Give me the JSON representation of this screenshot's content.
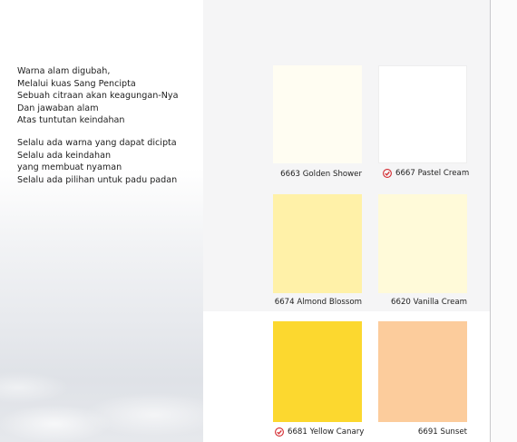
{
  "poem": {
    "stanza1": [
      "Warna alam digubah,",
      "Melalui kuas Sang Pencipta",
      "Sebuah citraan akan keagungan-Nya",
      "Dan jawaban alam",
      "Atas tuntutan keindahan"
    ],
    "stanza2": [
      "Selalu ada warna yang dapat dicipta",
      "Selalu ada keindahan",
      "yang membuat nyaman",
      "Selalu ada pilihan untuk padu padan"
    ]
  },
  "swatches": [
    {
      "code_name": "6663 Golden Shower",
      "color": "#fffdf2",
      "badge": false
    },
    {
      "code_name": "6667 Pastel Cream",
      "color": "#ffffff",
      "badge": true
    },
    {
      "code_name": "6674 Almond Blossom",
      "color": "#fff1a8",
      "badge": false
    },
    {
      "code_name": "6620 Vanilla Cream",
      "color": "#fffad9",
      "badge": false
    },
    {
      "code_name": "6681 Yellow Canary",
      "color": "#fcd82f",
      "badge": true
    },
    {
      "code_name": "6691 Sunset",
      "color": "#fccc9c",
      "badge": false
    }
  ],
  "colors": {
    "badge_red": "#d3282e"
  },
  "icons": {
    "badge": "check-shield-icon"
  }
}
